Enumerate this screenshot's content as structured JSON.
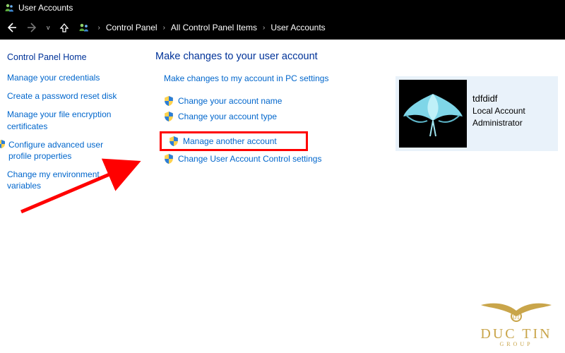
{
  "window": {
    "title": "User Accounts"
  },
  "breadcrumb": {
    "items": [
      "Control Panel",
      "All Control Panel Items",
      "User Accounts"
    ]
  },
  "sidebar": {
    "home": "Control Panel Home",
    "links": [
      "Manage your credentials",
      "Create a password reset disk",
      "Manage your file encryption certificates",
      "Configure advanced user profile properties",
      "Change my environment variables"
    ]
  },
  "main": {
    "heading": "Make changes to your user account",
    "pc_settings_link": "Make changes to my account in PC settings",
    "links": [
      "Change your account name",
      "Change your account type",
      "Manage another account",
      "Change User Account Control settings"
    ]
  },
  "account": {
    "name": "tdfdidf",
    "type": "Local Account",
    "role": "Administrator"
  },
  "watermark": {
    "brand": "DUC TIN",
    "sub": "GROUP"
  }
}
